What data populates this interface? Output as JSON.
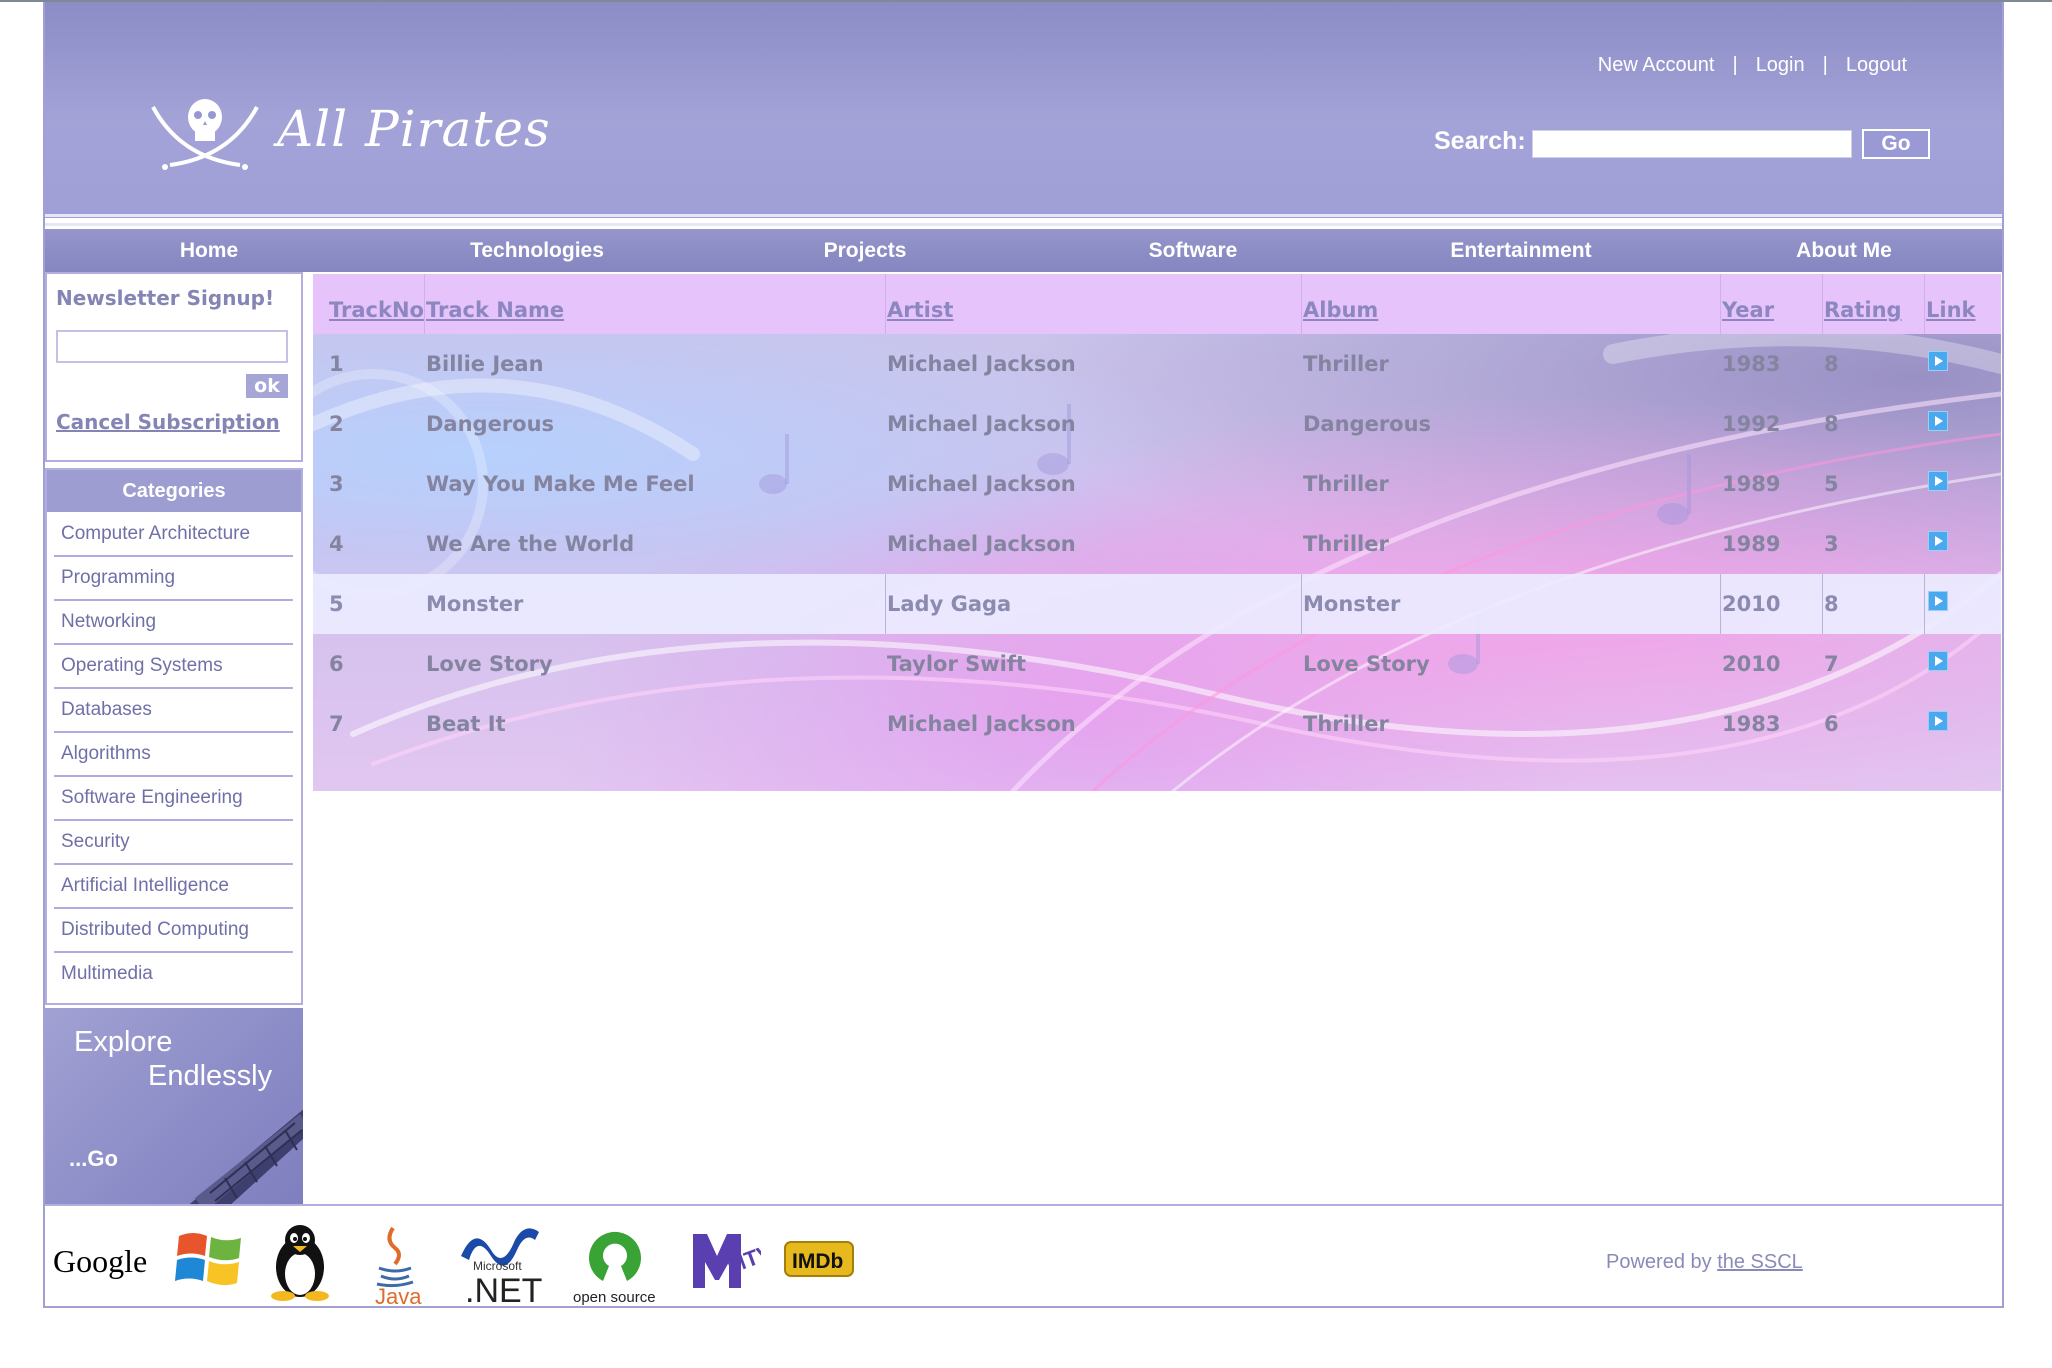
{
  "site": {
    "name": "All Pirates",
    "account_links": [
      "New Account",
      "Login",
      "Logout"
    ],
    "search": {
      "label": "Search:",
      "value": "",
      "button": "Go"
    }
  },
  "nav": [
    "Home",
    "Technologies",
    "Projects",
    "Software",
    "Entertainment",
    "About Me"
  ],
  "newsletter": {
    "title": "Newsletter Signup!",
    "input_value": "",
    "ok_label": "ok",
    "cancel_label": "Cancel Subscription"
  },
  "categories": {
    "title": "Categories",
    "items": [
      "Computer Architecture",
      "Programming",
      "Networking",
      "Operating Systems",
      "Databases",
      "Algorithms",
      "Software Engineering",
      "Security",
      "Artificial Intelligence",
      "Distributed Computing",
      "Multimedia"
    ]
  },
  "explore": {
    "line1": "Explore",
    "line2": "Endlessly",
    "go": "...Go"
  },
  "tracks": {
    "columns": [
      "TrackNo",
      "Track Name",
      "Artist",
      "Album",
      "Year",
      "Rating",
      "Link"
    ],
    "rows": [
      {
        "no": "1",
        "name": "Billie Jean",
        "artist": "Michael Jackson",
        "album": "Thriller",
        "year": "1983",
        "rating": "8"
      },
      {
        "no": "2",
        "name": "Dangerous",
        "artist": "Michael Jackson",
        "album": "Dangerous",
        "year": "1992",
        "rating": "8"
      },
      {
        "no": "3",
        "name": "Way You Make Me Feel",
        "artist": "Michael Jackson",
        "album": "Thriller",
        "year": "1989",
        "rating": "5"
      },
      {
        "no": "4",
        "name": "We Are the World",
        "artist": "Michael Jackson",
        "album": "Thriller",
        "year": "1989",
        "rating": "3"
      },
      {
        "no": "5",
        "name": "Monster",
        "artist": "Lady Gaga",
        "album": "Monster",
        "year": "2010",
        "rating": "8"
      },
      {
        "no": "6",
        "name": "Love Story",
        "artist": "Taylor Swift",
        "album": "Love Story",
        "year": "2010",
        "rating": "7"
      },
      {
        "no": "7",
        "name": "Beat It",
        "artist": "Michael Jackson",
        "album": "Thriller",
        "year": "1983",
        "rating": "6"
      }
    ],
    "highlighted_row": "5",
    "link_icon": "play-icon"
  },
  "footer": {
    "logos": [
      "Google",
      "Windows",
      "Linux",
      "Java",
      "Microsoft .NET",
      "open source",
      "MTV",
      "IMDb"
    ],
    "logo_texts": {
      "google": "Google",
      "java": "Java",
      "ms": "Microsoft",
      "net": ".NET",
      "opensource": "open source",
      "mtv": "MTV",
      "imdb": "IMDb"
    },
    "powered_prefix": "Powered by",
    "powered_link": "the SSCL"
  },
  "colors": {
    "accent": "#9d9dd2",
    "header": "#a3a3d8",
    "text_link": "#8585b5",
    "table_header": "#e6c3fa"
  }
}
